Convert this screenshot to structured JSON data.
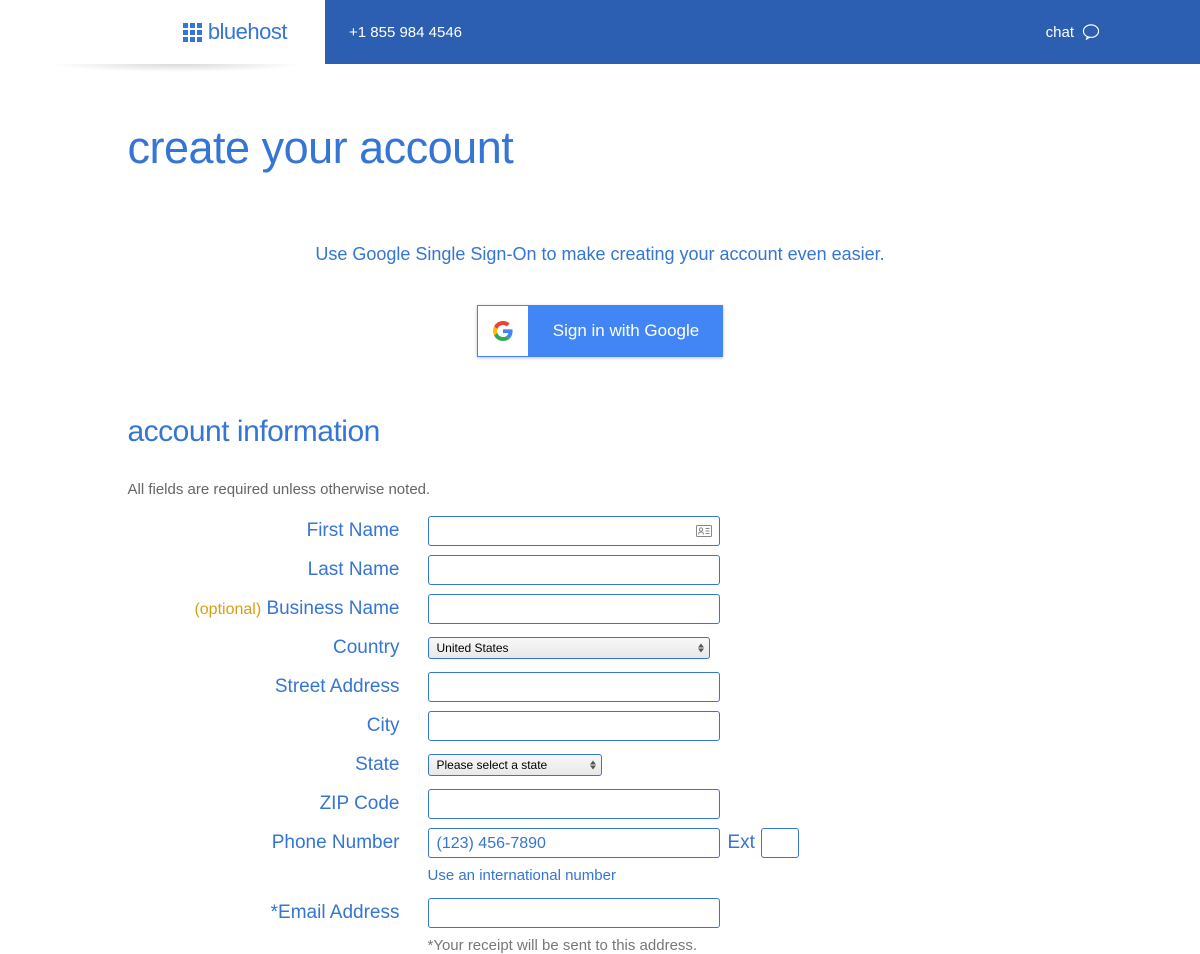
{
  "header": {
    "logo_text": "bluehost",
    "phone": "+1 855 984 4546",
    "chat_label": "chat"
  },
  "page": {
    "title": "create your account",
    "sso_prompt": "Use Google Single Sign-On to make creating your account even easier.",
    "google_button": "Sign in with Google"
  },
  "section": {
    "title": "account information",
    "required_note": "All fields are required unless otherwise noted."
  },
  "form": {
    "first_name": {
      "label": "First Name",
      "value": ""
    },
    "last_name": {
      "label": "Last Name",
      "value": ""
    },
    "business_name": {
      "label": "Business Name",
      "optional": "(optional)",
      "value": ""
    },
    "country": {
      "label": "Country",
      "selected": "United States"
    },
    "street_address": {
      "label": "Street Address",
      "value": ""
    },
    "city": {
      "label": "City",
      "value": ""
    },
    "state": {
      "label": "State",
      "selected": "Please select a state"
    },
    "zip": {
      "label": "ZIP Code",
      "value": ""
    },
    "phone": {
      "label": "Phone Number",
      "placeholder": "(123) 456-7890",
      "value": "",
      "ext_label": "Ext",
      "intl_link": "Use an international number"
    },
    "email": {
      "label": "*Email Address",
      "value": "",
      "helper": "*Your receipt will be sent to this address."
    }
  }
}
